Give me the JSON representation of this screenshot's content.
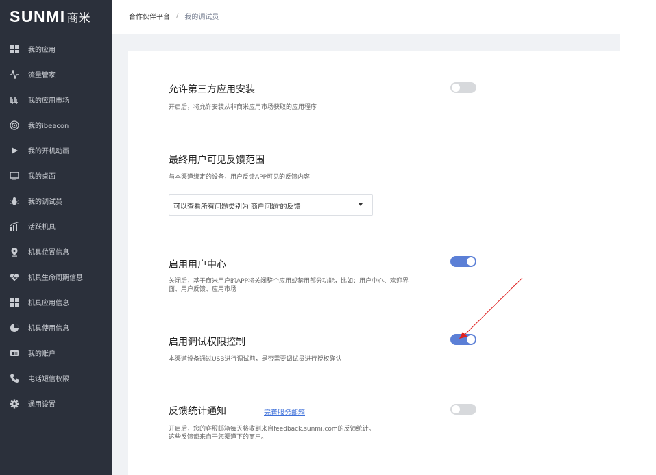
{
  "brand": {
    "logo_latin": "SUNMI",
    "logo_cjk": "商米"
  },
  "sidebar": {
    "items": [
      {
        "label": "我的应用",
        "icon": "grid-icon"
      },
      {
        "label": "流量管家",
        "icon": "pulse-icon"
      },
      {
        "label": "我的应用市场",
        "icon": "market-icon"
      },
      {
        "label": "我的ibeacon",
        "icon": "beacon-icon"
      },
      {
        "label": "我的开机动画",
        "icon": "play-icon"
      },
      {
        "label": "我的桌面",
        "icon": "monitor-icon"
      },
      {
        "label": "我的调试员",
        "icon": "bug-icon"
      },
      {
        "label": "活跃机具",
        "icon": "bar-chart-icon"
      },
      {
        "label": "机具位置信息",
        "icon": "location-pin-icon"
      },
      {
        "label": "机具生命周期信息",
        "icon": "heart-icon"
      },
      {
        "label": "机具应用信息",
        "icon": "apps-grid-icon"
      },
      {
        "label": "机具使用信息",
        "icon": "pie-chart-icon"
      },
      {
        "label": "我的账户",
        "icon": "id-card-icon"
      },
      {
        "label": "电话短信权限",
        "icon": "phone-icon"
      },
      {
        "label": "通用设置",
        "icon": "gear-icon"
      }
    ]
  },
  "breadcrumb": {
    "root": "合作伙伴平台",
    "separator": "/",
    "current": "我的调试员"
  },
  "settings": {
    "third_party": {
      "title": "允许第三方应用安装",
      "desc": "开启后，将允许安装从非商米应用市场获取的应用程序",
      "enabled": false
    },
    "feedback_scope": {
      "title": "最终用户可见反馈范围",
      "desc": "与本渠道绑定的设备，用户反馈APP可见的反馈内容",
      "selected": "可以查看所有问题类别为'商户问题'的反馈"
    },
    "user_center": {
      "title": "启用用户中心",
      "desc": "关闭后，基于商米用户的APP将关闭整个应用或禁用部分功能，比如：用户中心、欢迎界面、用户反馈、应用市场",
      "enabled": true
    },
    "debug_permission": {
      "title": "启用调试权限控制",
      "desc": "本渠道设备通过USB进行调试前，是否需要调试员进行授权确认",
      "enabled": true
    },
    "feedback_notify": {
      "title": "反馈统计通知",
      "link": "完善服务邮箱",
      "desc_line1": "开启后，您的客服邮箱每天将收到来自feedback.sunmi.com的反馈统计。",
      "desc_line2": "这些反馈都来自于您渠道下的商户。",
      "enabled": false
    }
  },
  "colors": {
    "sidebar_bg": "#2b303b",
    "toggle_on": "#5b7fd6",
    "toggle_off": "#d7d9dc",
    "link": "#3d6fd9",
    "annotation_arrow": "#e02020"
  }
}
